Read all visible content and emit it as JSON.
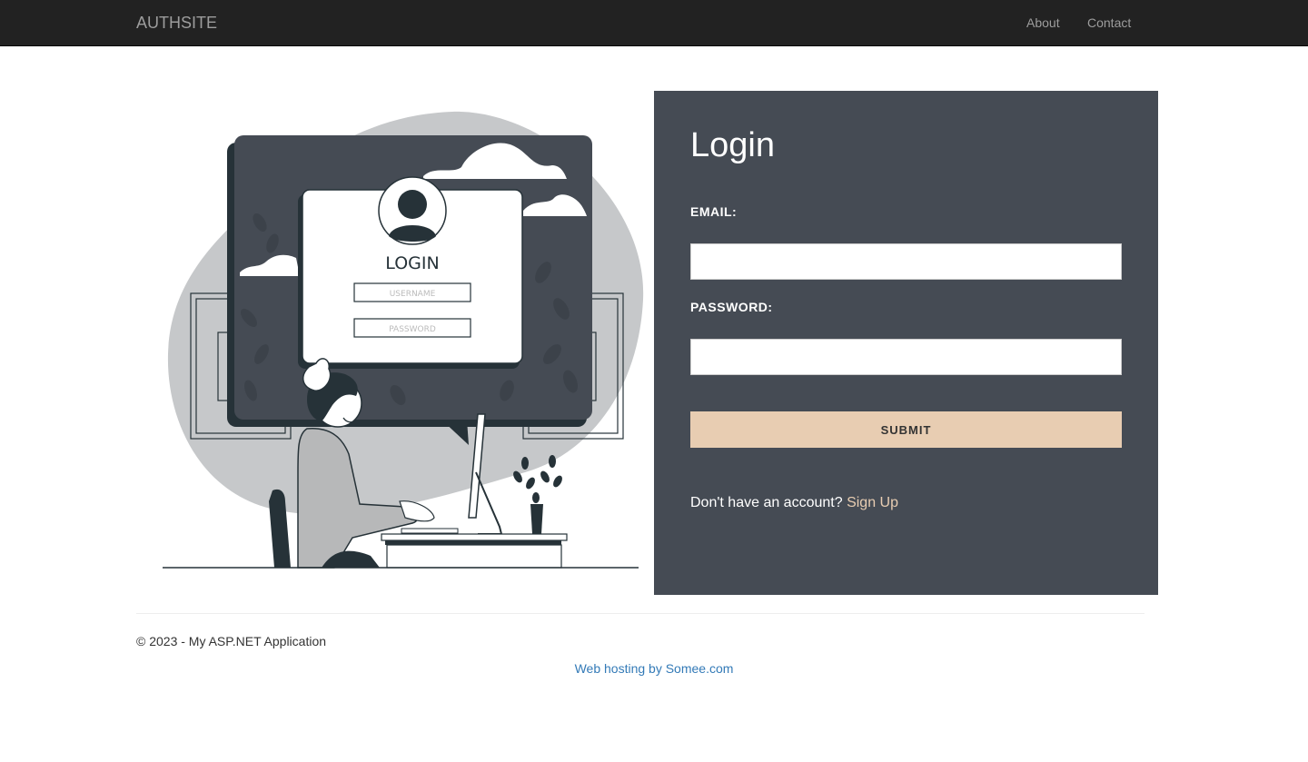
{
  "navbar": {
    "brand": "AUTHSITE",
    "links": [
      {
        "label": "About"
      },
      {
        "label": "Contact"
      }
    ]
  },
  "illustration": {
    "login_label": "LOGIN",
    "username_placeholder": "USERNAME",
    "password_placeholder": "PASSWORD"
  },
  "login": {
    "title": "Login",
    "email_label": "EMAIL:",
    "email_value": "",
    "password_label": "PASSWORD:",
    "password_value": "",
    "submit_label": "SUBMIT",
    "no_account_text": "Don't have an account?",
    "signup_label": "Sign Up"
  },
  "footer": {
    "copyright": "© 2023 - My ASP.NET Application",
    "hosting_link": "Web hosting by Somee.com"
  },
  "colors": {
    "navbar_bg": "#222222",
    "panel_bg": "#454b54",
    "accent": "#e8cdb2",
    "link": "#337ab7"
  }
}
